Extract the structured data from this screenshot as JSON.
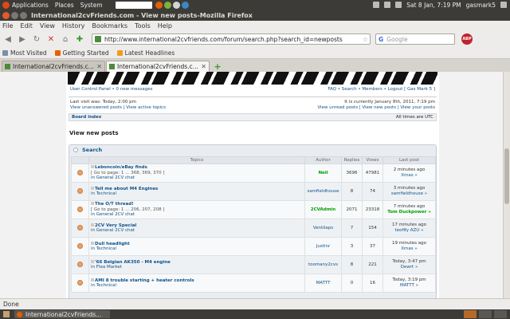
{
  "panel": {
    "menus": [
      "Applications",
      "Places",
      "System"
    ],
    "clock": "Sat 8 Jan, 7:19 PM",
    "user": "gasmark5"
  },
  "window": {
    "title": "International2cvFriends.com - View new posts-Mozilla Firefox"
  },
  "menubar": [
    "File",
    "Edit",
    "View",
    "History",
    "Bookmarks",
    "Tools",
    "Help"
  ],
  "nav": {
    "url": "http://www.international2cvfriends.com/forum/search.php?search_id=newposts",
    "search_placeholder": "Google",
    "abp_label": "ABP"
  },
  "bookmarks": [
    "Most Visited",
    "Getting Started",
    "Latest Headlines"
  ],
  "tabs": [
    {
      "label": "International2cvFriends.c..."
    },
    {
      "label": "International2cvFriends.c..."
    }
  ],
  "forum": {
    "ucp_left": "User Control Panel • 0 new messages",
    "ucp_right": "FAQ • Search • Members • Logout [ Gas Mark 5 ]",
    "last_visit": "Last visit was: Today, 2:00 pm",
    "left_links": "View unanswered posts | View active topics",
    "current_time": "It is currently January 8th, 2011, 7:19 pm",
    "right_links": "View unread posts | View new posts | View your posts",
    "board_index": "Board index",
    "timezone": "All times are UTC",
    "heading": "View new posts",
    "panel_title": "Search",
    "columns": [
      "Topics",
      "Author",
      "Replies",
      "Views",
      "Last post"
    ],
    "rows": [
      {
        "title": "Leboncoin/eBay finds",
        "pages": "[ Go to page: 1 ... 368, 369, 370 ]",
        "forum": "in General 2CV chat",
        "author": "Neil",
        "author_admin": true,
        "replies": "3696",
        "views": "47981",
        "last_time": "2 minutes ago",
        "last_by": "Xmas",
        "last_admin": false
      },
      {
        "title": "Tell me about M4 Engines",
        "pages": "",
        "forum": "in Technical",
        "author": "samfieldhouse",
        "author_admin": false,
        "replies": "8",
        "views": "74",
        "last_time": "3 minutes ago",
        "last_by": "samfieldhouse",
        "last_admin": false
      },
      {
        "title": "The O/T thread!",
        "pages": "[ Go to page: 1 ... 206, 207, 208 ]",
        "forum": "in General 2CV chat",
        "author": "2CVAdmin",
        "author_admin": true,
        "replies": "2071",
        "views": "23318",
        "last_time": "7 minutes ago",
        "last_by": "Tom Duckpower",
        "last_admin": true
      },
      {
        "title": "2CV Very Special",
        "pages": "",
        "forum": "in General 2CV chat",
        "author": "Ventilaps",
        "author_admin": false,
        "replies": "7",
        "views": "154",
        "last_time": "17 minutes ago",
        "last_by": "teofify AZU",
        "last_admin": false
      },
      {
        "title": "Dull headlight",
        "pages": "",
        "forum": "in Technical",
        "author": "Justinr",
        "author_admin": false,
        "replies": "3",
        "views": "37",
        "last_time": "19 minutes ago",
        "last_by": "Xmas",
        "last_admin": false
      },
      {
        "title": "'66 Belgian AK350 - M4 engine",
        "pages": "",
        "forum": "in Flea Market",
        "author": "toomany2cvs",
        "author_admin": false,
        "replies": "8",
        "views": "221",
        "last_time": "Today, 3:47 pm",
        "last_by": "Dewrt",
        "last_admin": false
      },
      {
        "title": "AMI 8 trouble starting + heater controls",
        "pages": "",
        "forum": "in Technical",
        "author": "MATTT",
        "author_admin": false,
        "replies": "0",
        "views": "16",
        "last_time": "Today, 3:19 pm",
        "last_by": "MATTT",
        "last_admin": false
      }
    ]
  },
  "status": "Done",
  "taskbar": {
    "item": "International2cvFriends..."
  }
}
